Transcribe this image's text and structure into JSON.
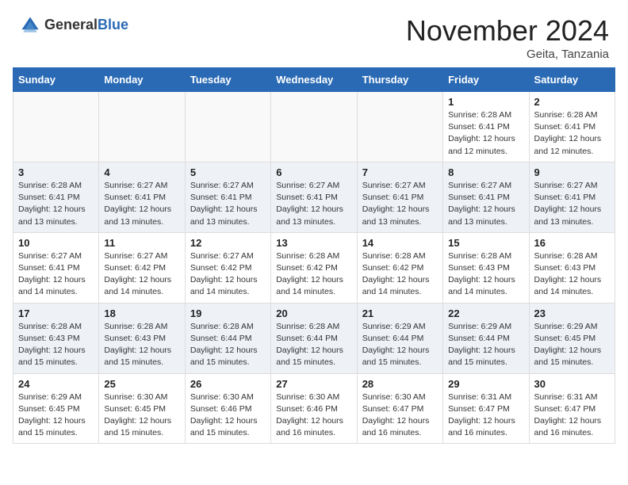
{
  "header": {
    "logo_general": "General",
    "logo_blue": "Blue",
    "month_title": "November 2024",
    "location": "Geita, Tanzania"
  },
  "days_of_week": [
    "Sunday",
    "Monday",
    "Tuesday",
    "Wednesday",
    "Thursday",
    "Friday",
    "Saturday"
  ],
  "weeks": [
    [
      {
        "day": "",
        "detail": ""
      },
      {
        "day": "",
        "detail": ""
      },
      {
        "day": "",
        "detail": ""
      },
      {
        "day": "",
        "detail": ""
      },
      {
        "day": "",
        "detail": ""
      },
      {
        "day": "1",
        "detail": "Sunrise: 6:28 AM\nSunset: 6:41 PM\nDaylight: 12 hours\nand 12 minutes."
      },
      {
        "day": "2",
        "detail": "Sunrise: 6:28 AM\nSunset: 6:41 PM\nDaylight: 12 hours\nand 12 minutes."
      }
    ],
    [
      {
        "day": "3",
        "detail": "Sunrise: 6:28 AM\nSunset: 6:41 PM\nDaylight: 12 hours\nand 13 minutes."
      },
      {
        "day": "4",
        "detail": "Sunrise: 6:27 AM\nSunset: 6:41 PM\nDaylight: 12 hours\nand 13 minutes."
      },
      {
        "day": "5",
        "detail": "Sunrise: 6:27 AM\nSunset: 6:41 PM\nDaylight: 12 hours\nand 13 minutes."
      },
      {
        "day": "6",
        "detail": "Sunrise: 6:27 AM\nSunset: 6:41 PM\nDaylight: 12 hours\nand 13 minutes."
      },
      {
        "day": "7",
        "detail": "Sunrise: 6:27 AM\nSunset: 6:41 PM\nDaylight: 12 hours\nand 13 minutes."
      },
      {
        "day": "8",
        "detail": "Sunrise: 6:27 AM\nSunset: 6:41 PM\nDaylight: 12 hours\nand 13 minutes."
      },
      {
        "day": "9",
        "detail": "Sunrise: 6:27 AM\nSunset: 6:41 PM\nDaylight: 12 hours\nand 13 minutes."
      }
    ],
    [
      {
        "day": "10",
        "detail": "Sunrise: 6:27 AM\nSunset: 6:41 PM\nDaylight: 12 hours\nand 14 minutes."
      },
      {
        "day": "11",
        "detail": "Sunrise: 6:27 AM\nSunset: 6:42 PM\nDaylight: 12 hours\nand 14 minutes."
      },
      {
        "day": "12",
        "detail": "Sunrise: 6:27 AM\nSunset: 6:42 PM\nDaylight: 12 hours\nand 14 minutes."
      },
      {
        "day": "13",
        "detail": "Sunrise: 6:28 AM\nSunset: 6:42 PM\nDaylight: 12 hours\nand 14 minutes."
      },
      {
        "day": "14",
        "detail": "Sunrise: 6:28 AM\nSunset: 6:42 PM\nDaylight: 12 hours\nand 14 minutes."
      },
      {
        "day": "15",
        "detail": "Sunrise: 6:28 AM\nSunset: 6:43 PM\nDaylight: 12 hours\nand 14 minutes."
      },
      {
        "day": "16",
        "detail": "Sunrise: 6:28 AM\nSunset: 6:43 PM\nDaylight: 12 hours\nand 14 minutes."
      }
    ],
    [
      {
        "day": "17",
        "detail": "Sunrise: 6:28 AM\nSunset: 6:43 PM\nDaylight: 12 hours\nand 15 minutes."
      },
      {
        "day": "18",
        "detail": "Sunrise: 6:28 AM\nSunset: 6:43 PM\nDaylight: 12 hours\nand 15 minutes."
      },
      {
        "day": "19",
        "detail": "Sunrise: 6:28 AM\nSunset: 6:44 PM\nDaylight: 12 hours\nand 15 minutes."
      },
      {
        "day": "20",
        "detail": "Sunrise: 6:28 AM\nSunset: 6:44 PM\nDaylight: 12 hours\nand 15 minutes."
      },
      {
        "day": "21",
        "detail": "Sunrise: 6:29 AM\nSunset: 6:44 PM\nDaylight: 12 hours\nand 15 minutes."
      },
      {
        "day": "22",
        "detail": "Sunrise: 6:29 AM\nSunset: 6:44 PM\nDaylight: 12 hours\nand 15 minutes."
      },
      {
        "day": "23",
        "detail": "Sunrise: 6:29 AM\nSunset: 6:45 PM\nDaylight: 12 hours\nand 15 minutes."
      }
    ],
    [
      {
        "day": "24",
        "detail": "Sunrise: 6:29 AM\nSunset: 6:45 PM\nDaylight: 12 hours\nand 15 minutes."
      },
      {
        "day": "25",
        "detail": "Sunrise: 6:30 AM\nSunset: 6:45 PM\nDaylight: 12 hours\nand 15 minutes."
      },
      {
        "day": "26",
        "detail": "Sunrise: 6:30 AM\nSunset: 6:46 PM\nDaylight: 12 hours\nand 15 minutes."
      },
      {
        "day": "27",
        "detail": "Sunrise: 6:30 AM\nSunset: 6:46 PM\nDaylight: 12 hours\nand 16 minutes."
      },
      {
        "day": "28",
        "detail": "Sunrise: 6:30 AM\nSunset: 6:47 PM\nDaylight: 12 hours\nand 16 minutes."
      },
      {
        "day": "29",
        "detail": "Sunrise: 6:31 AM\nSunset: 6:47 PM\nDaylight: 12 hours\nand 16 minutes."
      },
      {
        "day": "30",
        "detail": "Sunrise: 6:31 AM\nSunset: 6:47 PM\nDaylight: 12 hours\nand 16 minutes."
      }
    ]
  ]
}
